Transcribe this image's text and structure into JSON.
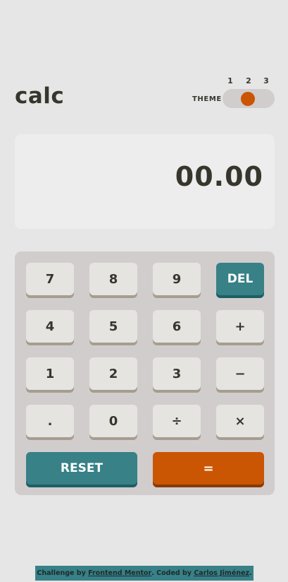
{
  "header": {
    "logo": "calc",
    "theme_label": "THEME",
    "theme_options": [
      "1",
      "2",
      "3"
    ],
    "selected_theme": "2"
  },
  "display": {
    "value": "00.00"
  },
  "keys": {
    "k7": "7",
    "k8": "8",
    "k9": "9",
    "del": "DEL",
    "k4": "4",
    "k5": "5",
    "k6": "6",
    "plus": "+",
    "k1": "1",
    "k2": "2",
    "k3": "3",
    "minus": "−",
    "dot": ".",
    "k0": "0",
    "divide": "÷",
    "times": "×",
    "reset": "RESET",
    "equals": "="
  },
  "footer": {
    "prefix": "Challenge by ",
    "link1": "Frontend Mentor",
    "middle": ". Coded by ",
    "link2": "Carlos Jiménez",
    "suffix": "."
  },
  "colors": {
    "background": "#e6e6e6",
    "accent_orange": "#ca5502",
    "accent_teal": "#378187",
    "key_light": "#e5e4e0",
    "text_dark": "#36362c"
  }
}
